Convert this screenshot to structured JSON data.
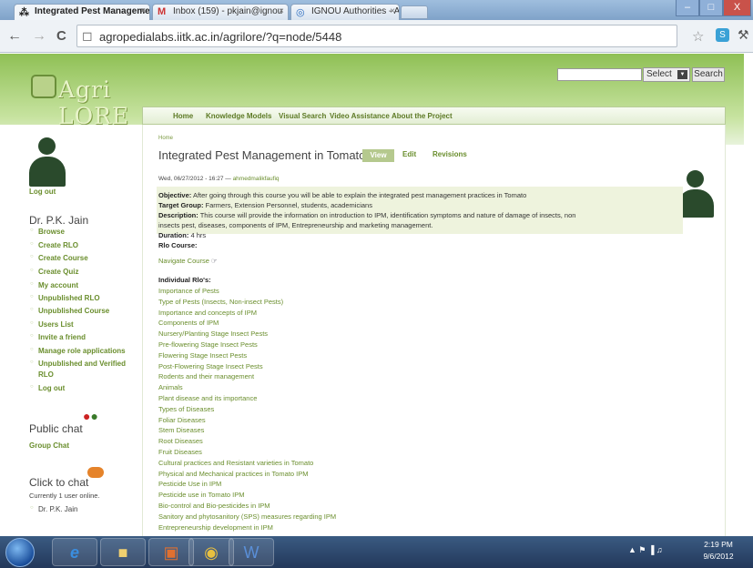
{
  "browser": {
    "tabs": [
      {
        "label": "Integrated Pest Manageme",
        "icon": "⁂"
      },
      {
        "label": "Inbox (159) - pkjain@ignou",
        "icon": "M"
      },
      {
        "label": "IGNOU Authorities - Acade",
        "icon": "◎"
      }
    ],
    "close_glyph": "×",
    "url": "agropedialabs.iitk.ac.in/agrilore/?q=node/5448",
    "back": "←",
    "forward": "→",
    "reload": "C",
    "star": "☆",
    "wrench": "⚒",
    "window_buttons": [
      "–",
      "□",
      "X"
    ]
  },
  "site": {
    "logo_text": "Agri LORE",
    "select_label": "Select",
    "search_label": "Search",
    "menu": [
      "Home",
      "Knowledge Models",
      "Visual Search",
      "Video Assistance",
      "About the Project"
    ]
  },
  "sidebar": {
    "logout_top": "Log out",
    "user_name": "Dr. P.K. Jain",
    "links": [
      "Browse",
      "Create RLO",
      "Create Course",
      "Create Quiz",
      "My account",
      "Unpublished RLO",
      "Unpublished Course",
      "Users List",
      "Invite a friend",
      "Manage role applications",
      "Unpublished and Verified",
      "RLO",
      "Log out"
    ],
    "public_chat": "Public chat",
    "group_chat": "Group Chat",
    "click_to_chat": "Click to chat",
    "online_text": "Currently 1 user online.",
    "online_user": "Dr. P.K. Jain"
  },
  "content": {
    "breadcrumb": "Home",
    "title": "Integrated Pest Management in Tomato",
    "tabs": {
      "view": "View",
      "edit": "Edit",
      "revisions": "Revisions"
    },
    "date": "Wed, 06/27/2012 - 16:27 —",
    "author": "ahmedmalikfaufiq",
    "objective_label": "Objective:",
    "objective": "After going through this course you will be able to explain the integrated pest management practices in Tomato",
    "target_label": "Target Group:",
    "target": "Farmers, Extension Personnel, students, academicians",
    "description_label": "Description:",
    "description_1": "This course will provide the information on introduction to IPM, identification symptoms and nature of damage of insects, non",
    "description_2": "insects pest, diseases, components of IPM, Entrepreneurship and marketing management.",
    "duration_label": "Duration:",
    "duration": "4 hrs",
    "rlo_course_label": "Rlo Course:",
    "navigate": "Navigate Course",
    "individual_label": "Individual Rlo's:",
    "rlos": [
      "Importance of Pests",
      "Type of Pests (Insects, Non-insect Pests)",
      "Importance and concepts of IPM",
      "Components of IPM",
      "Nursery/Planting Stage Insect Pests",
      "Pre-flowering Stage Insect Pests",
      "Flowering Stage Insect Pests",
      "Post-Flowering Stage Insect Pests",
      "Rodents and their management",
      "Animals",
      "Plant disease and its importance",
      "Types of Diseases",
      "Foliar Diseases",
      "Stem Diseases",
      "Root Diseases",
      "Fruit Diseases",
      "Cultural practices and Resistant varieties in Tomato",
      "Physical and Mechanical practices in Tomato IPM",
      "Pesticide Use in IPM",
      "Pesticide use in Tomato IPM",
      "Bio-control and Bio-pesticides in IPM",
      "Sanitory and phytosanitory (SPS) measures regarding IPM",
      "Entrepreneurship development in IPM"
    ]
  },
  "taskbar": {
    "time": "2:19 PM",
    "date": "9/6/2012",
    "tray": "▲  ⚑  ▐  ♫"
  }
}
